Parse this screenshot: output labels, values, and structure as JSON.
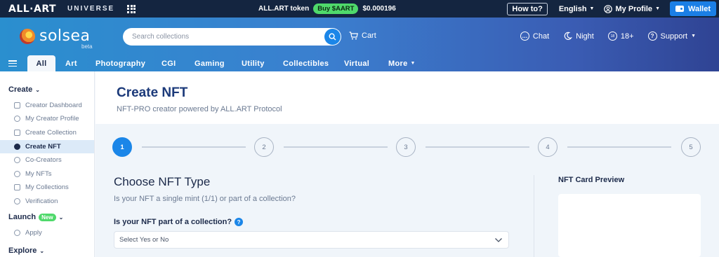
{
  "topbar": {
    "brand": "ALL·ART",
    "universe": "UNIVERSE",
    "token_label": "ALL.ART token",
    "buy_label": "Buy $AART",
    "price": "$0.000196",
    "howto": "How to?",
    "language": "English",
    "profile": "My Profile",
    "wallet": "Wallet"
  },
  "header": {
    "logo": "solsea",
    "beta": "beta",
    "search_placeholder": "Search collections",
    "cart": "Cart",
    "chat": "Chat",
    "night": "Night",
    "age": "18+",
    "support": "Support"
  },
  "categories": [
    "All",
    "Art",
    "Photography",
    "CGI",
    "Gaming",
    "Utility",
    "Collectibles",
    "Virtual",
    "More"
  ],
  "sidebar": {
    "create_title": "Create",
    "create_items": [
      "Creator Dashboard",
      "My Creator Profile",
      "Create Collection",
      "Create NFT",
      "Co-Creators",
      "My NFTs",
      "My Collections",
      "Verification"
    ],
    "launch_title": "Launch",
    "new_badge": "New",
    "launch_items": [
      "Apply"
    ],
    "explore_title": "Explore"
  },
  "main": {
    "title": "Create NFT",
    "subtitle": "NFT-PRO creator powered by ALL.ART Protocol",
    "steps": [
      "1",
      "2",
      "3",
      "4",
      "5"
    ],
    "current_step": 1,
    "section_title": "Choose NFT Type",
    "question": "Is your NFT a single mint (1/1) or part of a collection?",
    "field_label": "Is your NFT part of a collection?",
    "select_placeholder": "Select Yes or No",
    "preview_title": "NFT Card Preview"
  },
  "colors": {
    "accent": "#1b86e8",
    "topbar": "#142540",
    "buy_pill": "#4fd96b"
  }
}
